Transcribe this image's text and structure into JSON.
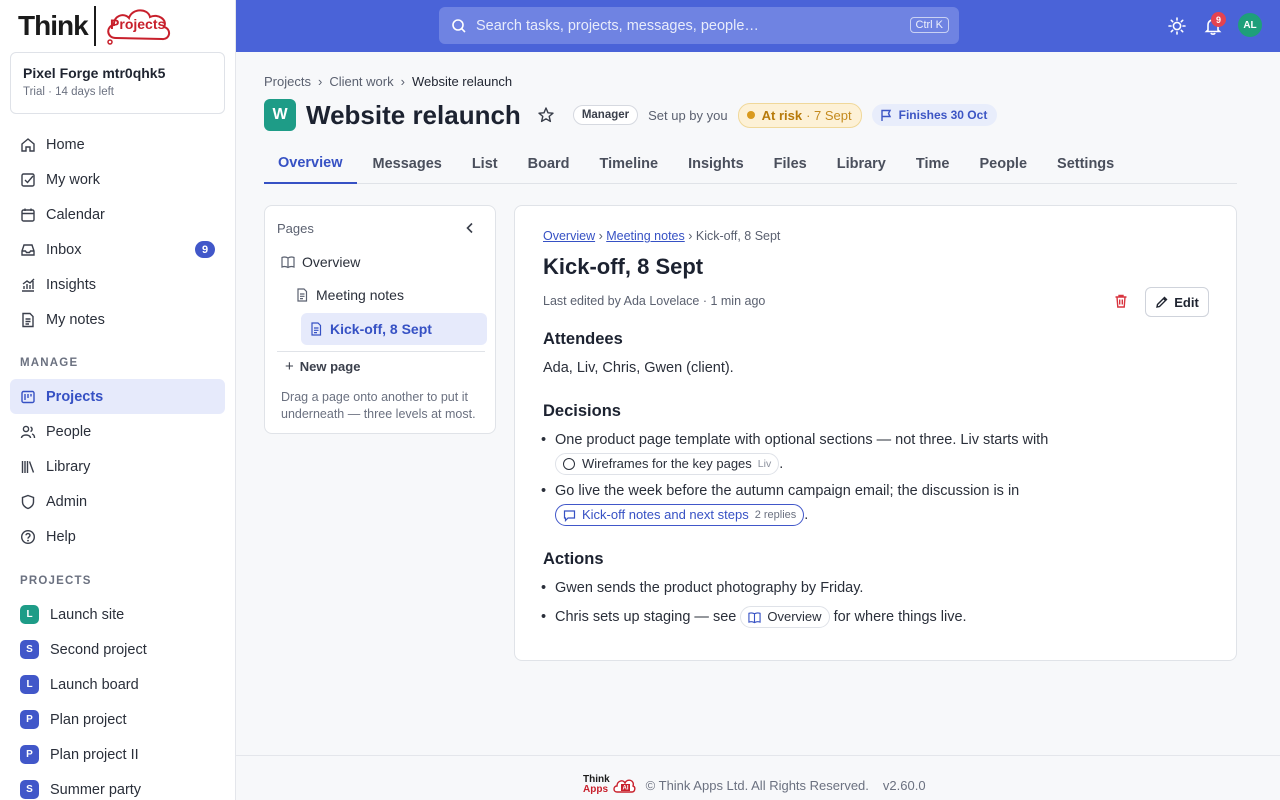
{
  "logo": {
    "word": "Think",
    "badge": "Projects"
  },
  "workspace": {
    "name": "Pixel Forge mtr0qhk5",
    "plan": "Trial",
    "trial_left": "· 14 days left"
  },
  "nav": [
    {
      "label": "Home",
      "icon": "home-icon"
    },
    {
      "label": "My work",
      "icon": "checkbox-icon"
    },
    {
      "label": "Calendar",
      "icon": "calendar-icon"
    },
    {
      "label": "Inbox",
      "icon": "inbox-icon",
      "badge": "9"
    },
    {
      "label": "Insights",
      "icon": "chart-icon"
    },
    {
      "label": "My notes",
      "icon": "note-icon"
    }
  ],
  "manage_label": "MANAGE",
  "manage": [
    {
      "label": "Projects",
      "icon": "projects-icon",
      "active": true
    },
    {
      "label": "People",
      "icon": "people-icon"
    },
    {
      "label": "Library",
      "icon": "library-icon"
    },
    {
      "label": "Admin",
      "icon": "shield-icon"
    },
    {
      "label": "Help",
      "icon": "help-icon"
    }
  ],
  "projects_label": "PROJECTS",
  "projects": [
    {
      "letter": "L",
      "label": "Launch site",
      "color": "#1e9c87"
    },
    {
      "letter": "S",
      "label": "Second project",
      "color": "#4157c9"
    },
    {
      "letter": "L",
      "label": "Launch board",
      "color": "#4157c9"
    },
    {
      "letter": "P",
      "label": "Plan project",
      "color": "#4157c9"
    },
    {
      "letter": "P",
      "label": "Plan project II",
      "color": "#4157c9"
    },
    {
      "letter": "S",
      "label": "Summer party",
      "color": "#4157c9"
    }
  ],
  "topbar": {
    "search_placeholder": "Search tasks, projects, messages, people…",
    "shortcut": "Ctrl K",
    "notif_count": "9",
    "avatar": "AL",
    "accent": "#4a63d8"
  },
  "breadcrumb": [
    "Projects",
    "Client work",
    "Website relaunch"
  ],
  "project": {
    "icon_letter": "W",
    "title": "Website relaunch",
    "role": "Manager",
    "setup": "Set up by you",
    "status": "At risk",
    "status_date": "· 7 Sept",
    "finish": "Finishes 30 Oct"
  },
  "tabs": [
    "Overview",
    "Messages",
    "List",
    "Board",
    "Timeline",
    "Insights",
    "Files",
    "Library",
    "Time",
    "People",
    "Settings"
  ],
  "pages": {
    "heading": "Pages",
    "tree": [
      "Overview",
      "Meeting notes",
      "Kick-off, 8 Sept"
    ],
    "new_page": "New page",
    "hint": "Drag a page onto another to put it underneath — three levels at most."
  },
  "doc": {
    "crumb_1": "Overview",
    "crumb_2": "Meeting notes",
    "crumb_3": "Kick-off, 8 Sept",
    "title": "Kick-off, 8 Sept",
    "meta": "Last edited by Ada Lovelace · 1 min ago",
    "edit": "Edit",
    "attendees_h": "Attendees",
    "attendees": "Ada, Liv, Chris, Gwen (client).",
    "decisions_h": "Decisions",
    "d1_text": "One product page template with optional sections — not three. Liv starts with",
    "d1_chip": "Wireframes for the key pages",
    "d1_chip_who": "Liv",
    "d2_text": "Go live the week before the autumn campaign email; the discussion is in",
    "d2_chip": "Kick-off notes and next steps",
    "d2_chip_count": "2 replies",
    "actions_h": "Actions",
    "a1": "Gwen sends the product photography by Friday.",
    "a2_pre": "Chris sets up staging — see",
    "a2_chip": "Overview",
    "a2_post": "for where things live."
  },
  "footer": {
    "logo_1": "Think",
    "logo_2": "Apps",
    "copyright": "© Think Apps Ltd. All Rights Reserved.",
    "version": "v2.60.0"
  }
}
